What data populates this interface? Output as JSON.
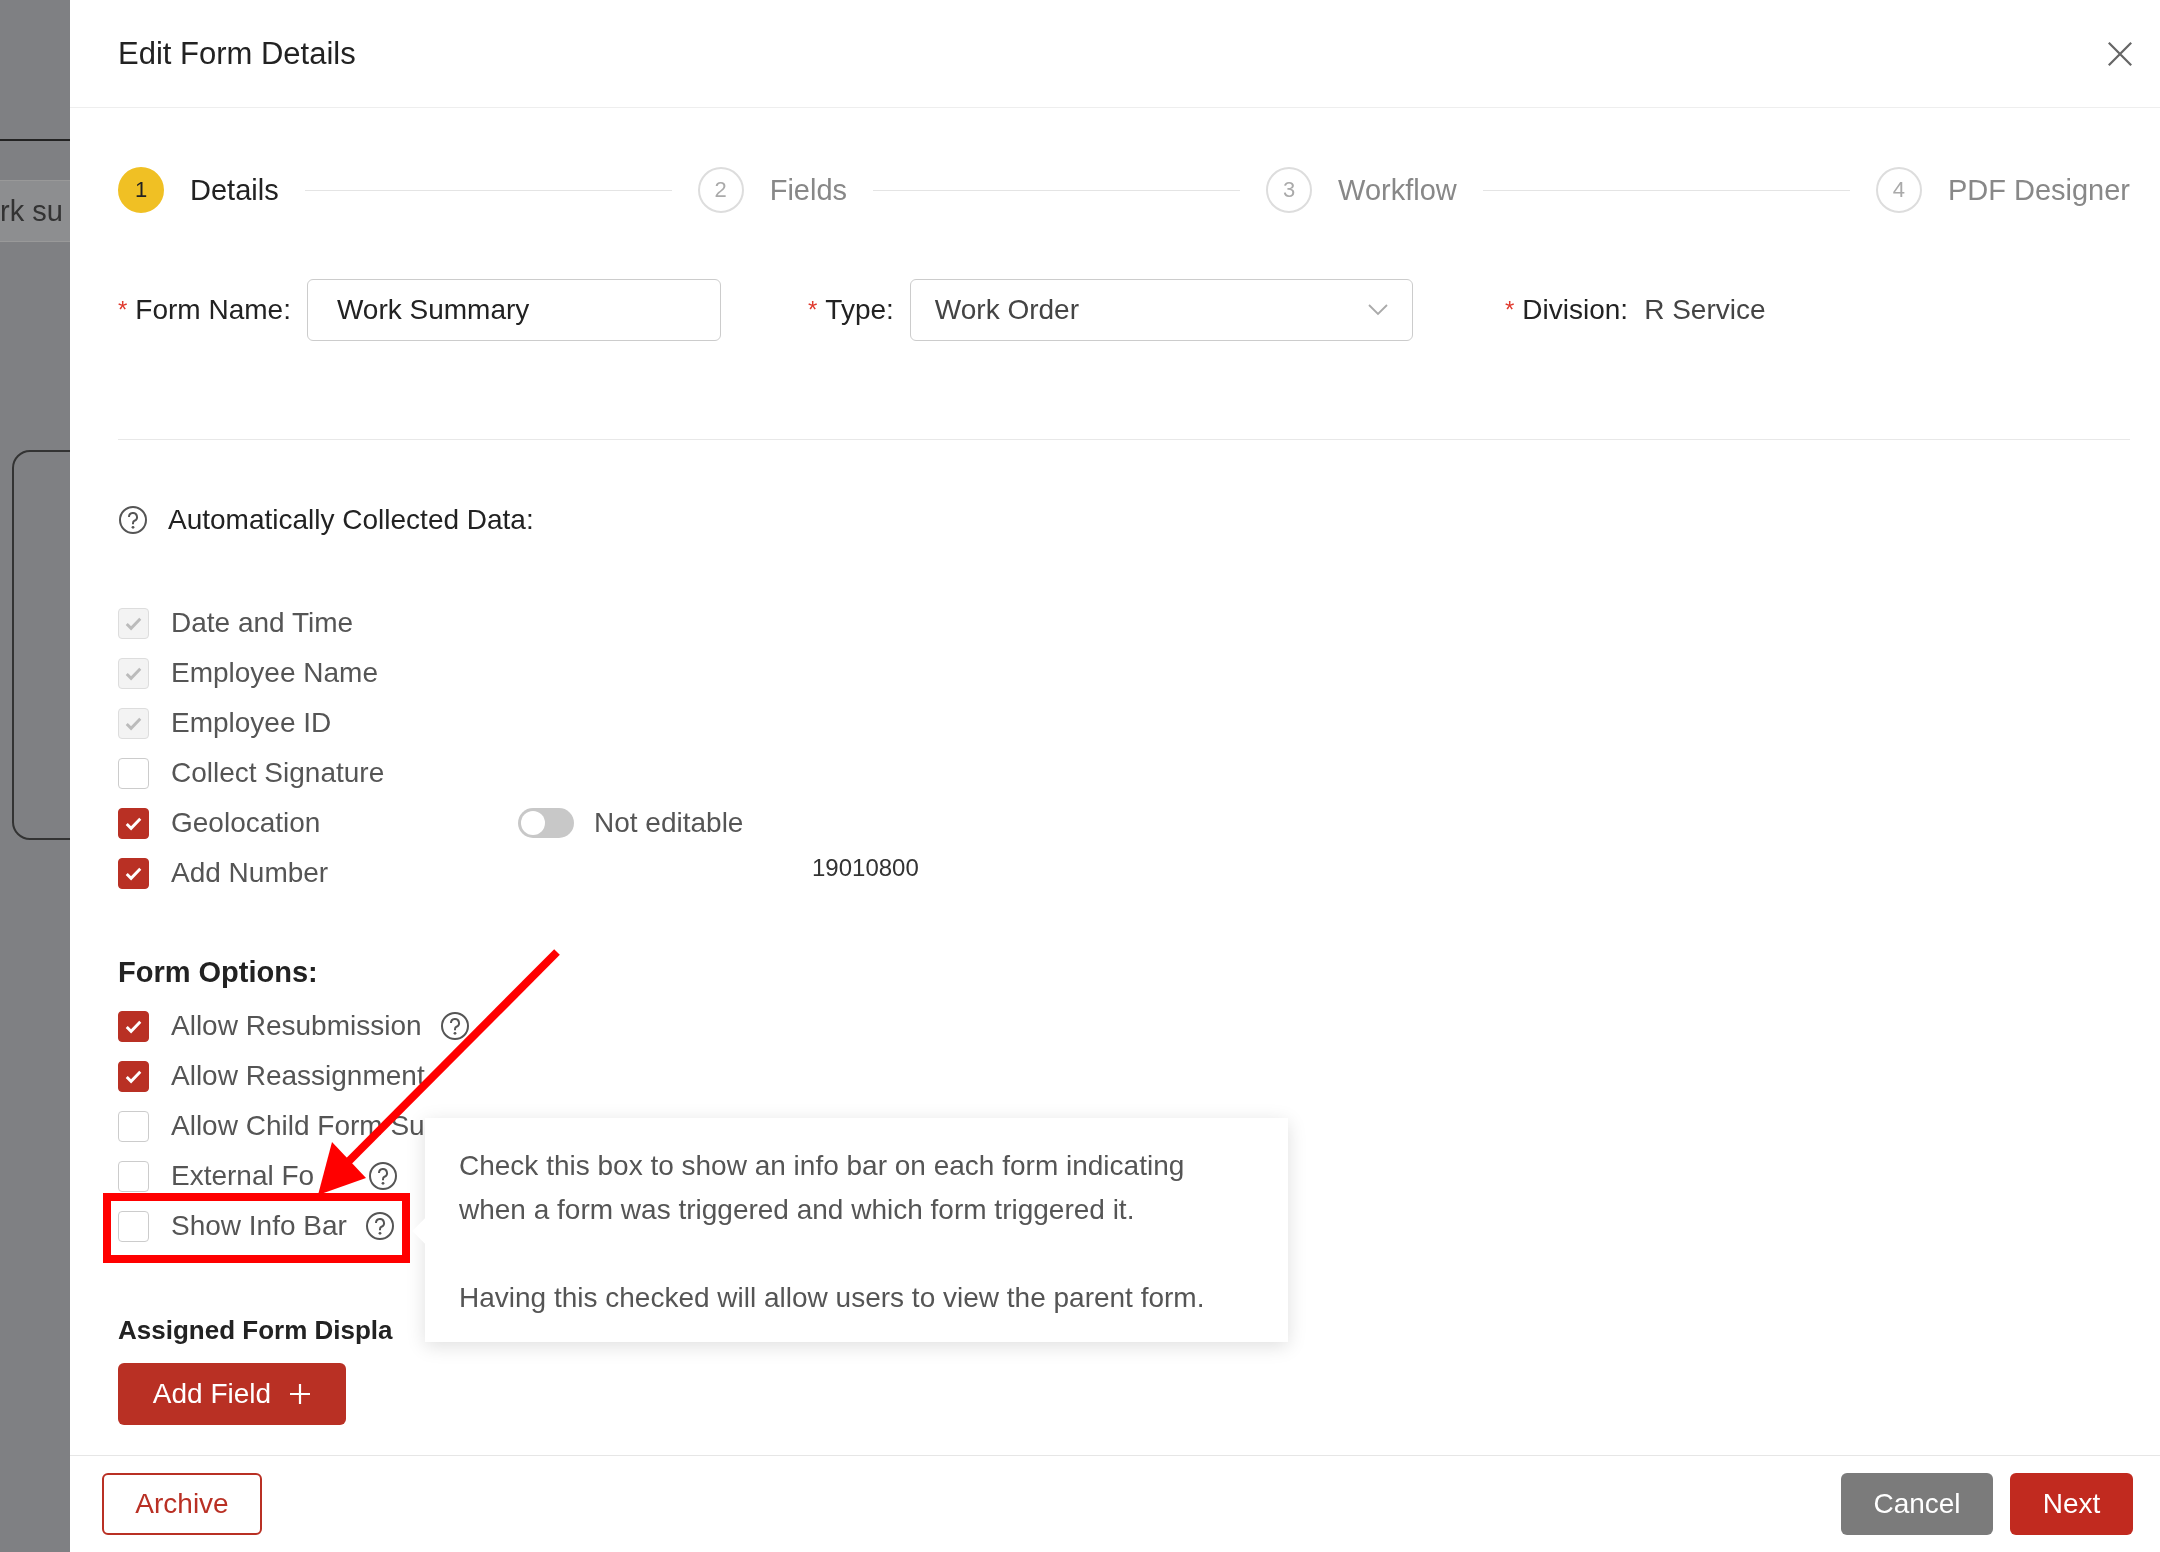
{
  "backdrop": {
    "tab_text": "rk su"
  },
  "dialog": {
    "title": "Edit Form Details"
  },
  "steps": [
    {
      "number": "1",
      "label": "Details",
      "selected": true
    },
    {
      "number": "2",
      "label": "Fields",
      "selected": false
    },
    {
      "number": "3",
      "label": "Workflow",
      "selected": false
    },
    {
      "number": "4",
      "label": "PDF Designer",
      "selected": false
    }
  ],
  "fields": [
    {
      "kind": "input",
      "required_mark": "*",
      "label": "Form Name:",
      "value": "Work Summary"
    },
    {
      "kind": "select",
      "required_mark": "*",
      "label": "Type:",
      "value": "Work Order"
    },
    {
      "kind": "text",
      "required_mark": "*",
      "label": "Division:",
      "value": "R Service"
    }
  ],
  "auto_data": {
    "heading": "Automatically Collected Data:",
    "items": [
      {
        "label": "Date and Time",
        "checked": true,
        "disabled": true
      },
      {
        "label": "Employee Name",
        "checked": true,
        "disabled": true
      },
      {
        "label": "Employee ID",
        "checked": true,
        "disabled": true
      },
      {
        "label": "Collect Signature",
        "checked": false,
        "disabled": false
      },
      {
        "label": "Geolocation",
        "checked": true,
        "disabled": false,
        "toggle": {
          "label": "Not editable",
          "on": false
        }
      },
      {
        "label": "Add Number",
        "checked": true,
        "disabled": false,
        "value": "19010800"
      }
    ]
  },
  "form_options": {
    "heading": "Form Options:",
    "items": [
      {
        "label": "Allow Resubmission",
        "checked": true,
        "help": true,
        "highlighted": false
      },
      {
        "label": "Allow Reassignment",
        "checked": true,
        "help": false,
        "highlighted": false
      },
      {
        "label": "Allow Child Form Su",
        "checked": false,
        "help": false,
        "highlighted": false
      },
      {
        "label": "External Fo",
        "checked": false,
        "help": true,
        "highlighted": false
      },
      {
        "label": "Show Info Bar",
        "checked": false,
        "help": true,
        "highlighted": true
      }
    ]
  },
  "tooltip": {
    "paragraphs": [
      "Check this box to show an info bar on each form indicating when a form was triggered and which form triggered it.",
      "Having this checked will allow users to view the parent form."
    ]
  },
  "assigned": {
    "heading": "Assigned Form Displa"
  },
  "add_field_button": "Add Field",
  "footer": {
    "archive": "Archive",
    "cancel": "Cancel",
    "next": "Next"
  }
}
